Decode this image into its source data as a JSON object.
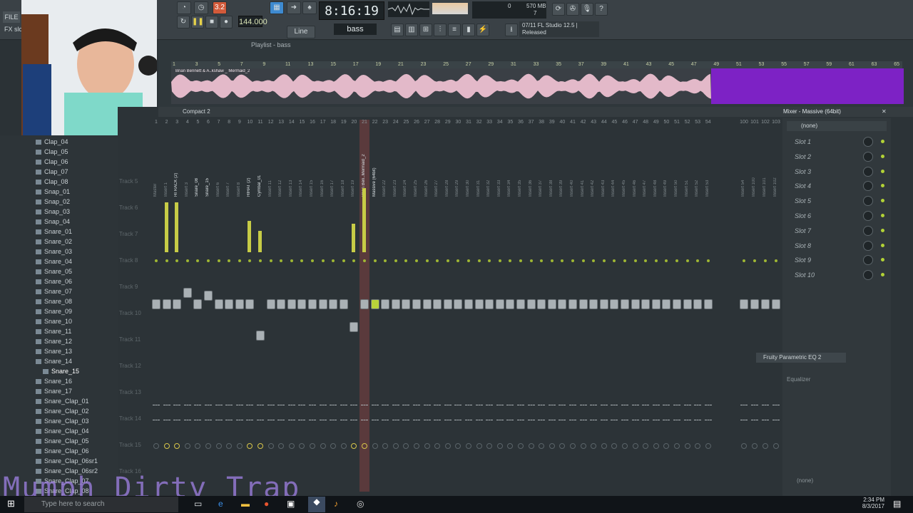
{
  "topbar": {
    "file": "FILE",
    "fx": "FX slot",
    "tempo": "144.000",
    "time": "8:16:19",
    "pattern": "bass",
    "line_mode": "Line",
    "cpu": "0",
    "ram": "570 MB",
    "voices": "7",
    "hint_line1": "07/11  FL Studio 12.5 |",
    "hint_line2": "Released",
    "pat_counter": "3.2"
  },
  "playlist": {
    "title": "Playlist - bass",
    "ruler": [
      "1",
      "3",
      "5",
      "7",
      "9",
      "11",
      "13",
      "15",
      "17",
      "19",
      "21",
      "23",
      "25",
      "27",
      "29",
      "31",
      "33",
      "35",
      "37",
      "39",
      "41",
      "43",
      "45",
      "47",
      "49",
      "51",
      "53",
      "55",
      "57",
      "59",
      "61",
      "63",
      "65"
    ],
    "clip_label": "Brian Bennett & A..kshaw _ Mermaid_2"
  },
  "mixer": {
    "preset": "Compact 2",
    "title": "Mixer - Massive (64bit)",
    "insert_none": "(none)",
    "tooltip": "Fruity Parametric EQ 2",
    "equalizer": "Equalizer",
    "footer_none": "(none)",
    "slots": [
      "Slot 1",
      "Slot 2",
      "Slot 3",
      "Slot 4",
      "Slot 5",
      "Slot 6",
      "Slot 7",
      "Slot 8",
      "Slot 9",
      "Slot 10"
    ],
    "tracks": [
      "Track 5",
      "Track 6",
      "Track 7",
      "Track 8",
      "Track 9",
      "Track 10",
      "Track 11",
      "Track 12",
      "Track 13",
      "Track 14",
      "Track 15",
      "Track 16"
    ],
    "channels": [
      "Master",
      "Insert 1",
      "HI RACK (2)",
      "Insert 3",
      "Snare_08",
      "Snare_15",
      "Insert 6",
      "Insert 7",
      "Insert 8",
      "HIHAT (2)",
      "Cymbal_01",
      "Insert 11",
      "Insert 12",
      "Insert 13",
      "Insert 14",
      "Insert 15",
      "Insert 16",
      "Insert 17",
      "Insert 18",
      "Insert 19",
      "Brian Ben..Mermaid_2",
      "Massive (64bit)",
      "Insert 22",
      "Insert 23",
      "Insert 24",
      "Insert 25",
      "Insert 26",
      "Insert 27",
      "Insert 28",
      "Insert 29",
      "Insert 30",
      "Insert 31",
      "Insert 32",
      "Insert 33",
      "Insert 34",
      "Insert 35",
      "Insert 36",
      "Insert 37",
      "Insert 38",
      "Insert 39",
      "Insert 40",
      "Insert 41",
      "Insert 42",
      "Insert 43",
      "Insert 44",
      "Insert 45",
      "Insert 46",
      "Insert 47",
      "Insert 48",
      "Insert 49",
      "Insert 50",
      "Insert 51",
      "Insert 52",
      "Insert 53",
      "Insert 54",
      "Insert 100",
      "Insert 101",
      "Insert 102",
      "Insert 103"
    ],
    "numbers": [
      "1",
      "2",
      "3",
      "4",
      "5",
      "6",
      "7",
      "8",
      "9",
      "10",
      "11",
      "12",
      "13",
      "14",
      "15",
      "16",
      "17",
      "18",
      "19",
      "20",
      "21",
      "22",
      "23",
      "24",
      "25",
      "26",
      "27",
      "28",
      "29",
      "30",
      "31",
      "32",
      "33",
      "34",
      "35",
      "36",
      "37",
      "38",
      "39",
      "40",
      "41",
      "42",
      "43",
      "44",
      "45",
      "46",
      "47",
      "48",
      "49",
      "50",
      "51",
      "52",
      "53",
      "54",
      "100",
      "101",
      "102",
      "103"
    ]
  },
  "browser": {
    "items": [
      "Clap_04",
      "Clap_05",
      "Clap_06",
      "Clap_07",
      "Clap_08",
      "Snap_01",
      "Snap_02",
      "Snap_03",
      "Snap_04",
      "Snare_01",
      "Snare_02",
      "Snare_03",
      "Snare_04",
      "Snare_05",
      "Snare_06",
      "Snare_07",
      "Snare_08",
      "Snare_09",
      "Snare_10",
      "Snare_11",
      "Snare_12",
      "Snare_13",
      "Snare_14",
      "Snare_15",
      "Snare_16",
      "Snare_17",
      "Snare_Clap_01",
      "Snare_Clap_02",
      "Snare_Clap_03",
      "Snare_Clap_04",
      "Snare_Clap_05",
      "Snare_Clap_06",
      "Snare_Clap_06sr1",
      "Snare_Clap_06sr2",
      "Snare_Clap_07",
      "Snare_Clap_08"
    ],
    "selected": "Snare_15"
  },
  "overlay_text": "Mumph Dirty Trap",
  "taskbar": {
    "search_placeholder": "Type here to search",
    "time": "2:34 PM",
    "date": "8/3/2017"
  },
  "colors": {
    "accent": "#c7cc46",
    "playlist_purple": "#7d22c5",
    "selected_strip": "#5a3a3c"
  }
}
